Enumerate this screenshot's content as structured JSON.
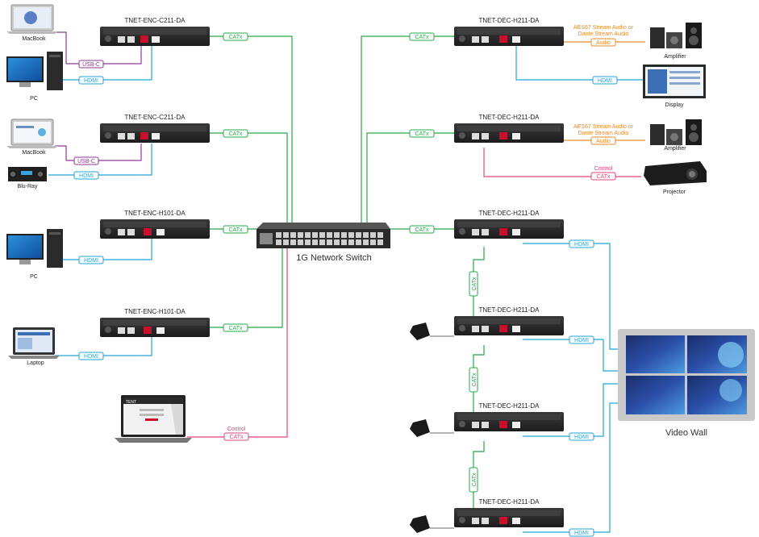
{
  "colors": {
    "catx": "#2aa84a",
    "hdmi": "#22a6d6",
    "usbc": "#8e3b96",
    "control": "#e0457b",
    "audio": "#e88a2a",
    "device": "#2a2a2a"
  },
  "encoders": {
    "enc1": "TNET-ENC-C211-DA",
    "enc2": "TNET-ENC-C211-DA",
    "enc3": "TNET-ENC-H101-DA",
    "enc4": "TNET-ENC-H101-DA"
  },
  "decoders": {
    "dec1": "TNET-DEC-H211-DA",
    "dec2": "TNET-DEC-H211-DA",
    "dec3": "TNET-DEC-H211-DA",
    "dec4": "TNET-DEC-H211-DA",
    "dec5": "TNET-DEC-H211-DA",
    "dec6": "TNET-DEC-H211-DA"
  },
  "sources": {
    "macbook1": "MacBook",
    "pc1": "PC",
    "macbook2": "MacBook",
    "bluray": "Blu-Ray",
    "pc2": "PC",
    "laptop": "Laptop"
  },
  "sinks": {
    "amp1": "Amplifier",
    "display": "Display",
    "amp2": "Amplifier",
    "projector": "Projector",
    "video_wall": "Video Wall"
  },
  "switch_label": "1G Network Switch",
  "cable_labels": {
    "catx": "CATx",
    "hdmi": "HDMI",
    "usbc": "USB-C",
    "audio": "Audio",
    "control": "Control",
    "audio_stream_1": "AES67 Stream Audio or",
    "audio_stream_2": "Dante Stream Audio"
  },
  "control_screen": {
    "logo": "TENT"
  }
}
